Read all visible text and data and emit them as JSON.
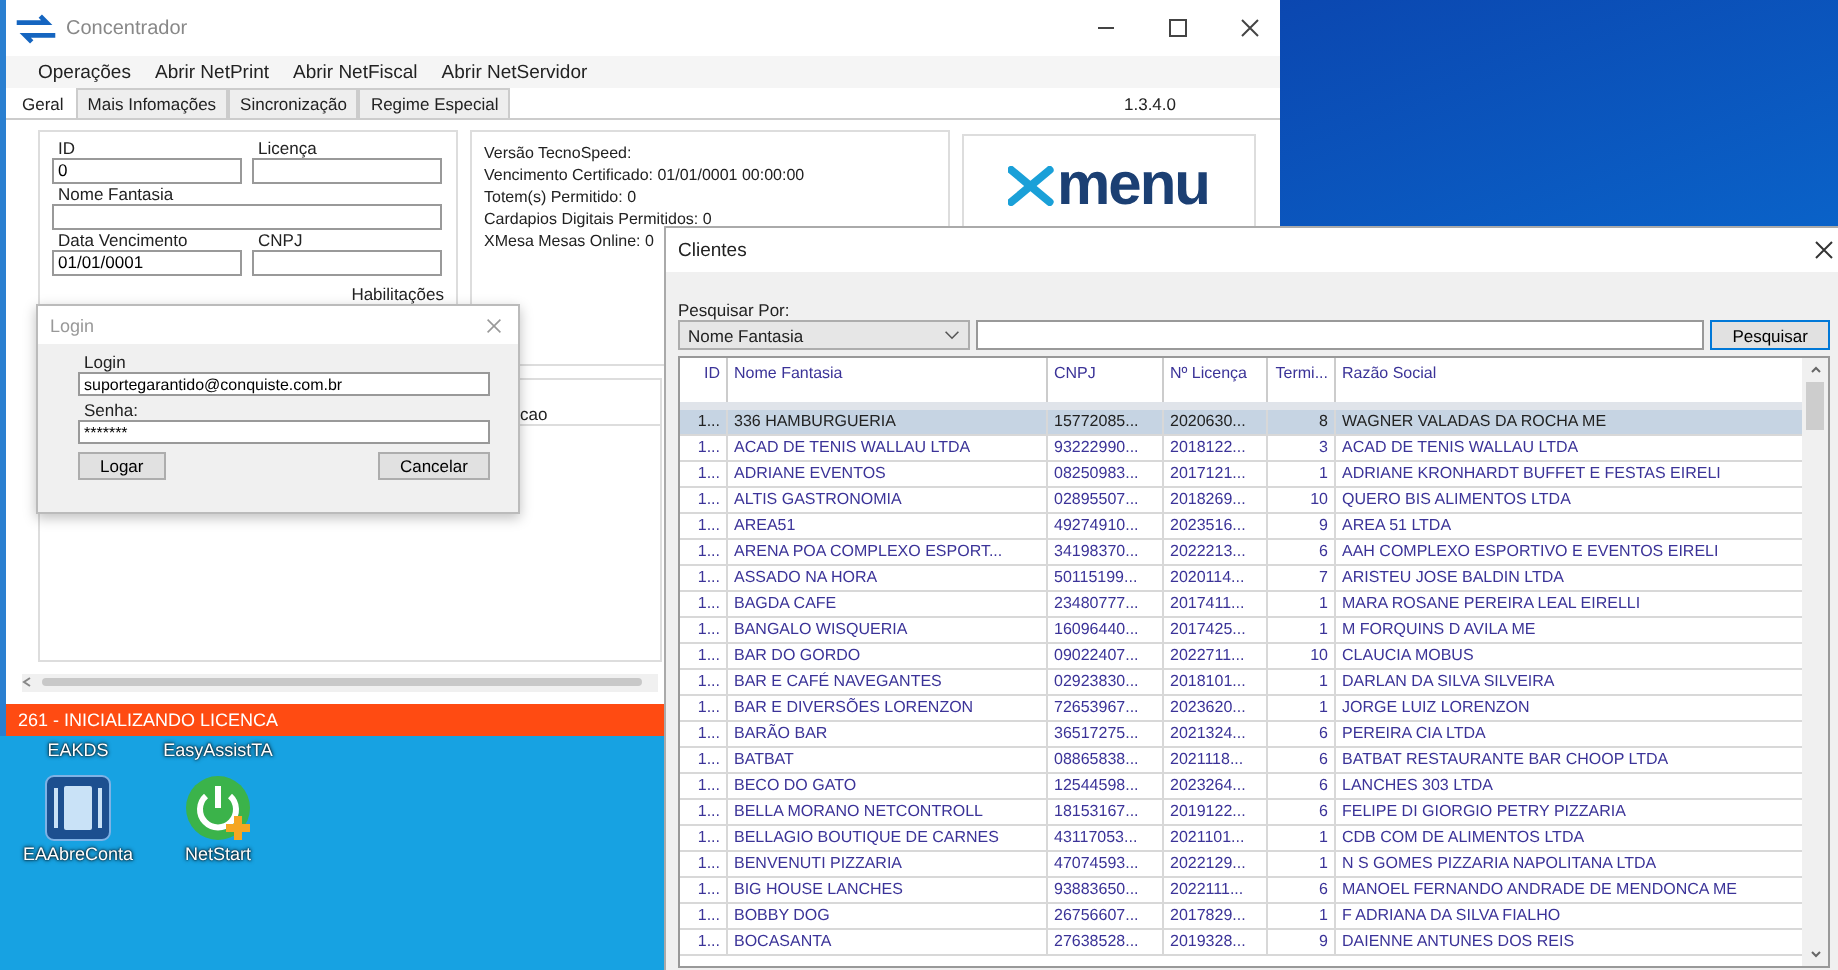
{
  "desktop": {
    "icons": [
      {
        "label": "EAKDS",
        "kind": "covered"
      },
      {
        "label": "EasyAssistTA",
        "kind": "covered"
      },
      {
        "label": "EAAbreConta",
        "kind": "menu-app"
      },
      {
        "label": "NetStart",
        "kind": "power-app"
      }
    ]
  },
  "main_window": {
    "title": "Concentrador",
    "menu": [
      "Operações",
      "Abrir NetPrint",
      "Abrir NetFiscal",
      "Abrir NetServidor"
    ],
    "tabs": [
      {
        "label": "Geral",
        "selected": true
      },
      {
        "label": "Mais Infomações",
        "selected": false
      },
      {
        "label": "Sincronização",
        "selected": false
      },
      {
        "label": "Regime Especial",
        "selected": false
      }
    ],
    "version": "1.3.4.0",
    "field_rows": [
      [
        {
          "label": "ID",
          "value": "0"
        },
        {
          "label": "Licença"
        }
      ],
      [
        {
          "label": "Nome Fantasia"
        }
      ],
      [
        {
          "label": "Data Vencimento",
          "value": "01/01/0001"
        },
        {
          "label": "CNPJ"
        }
      ]
    ],
    "section_label": "Habilitações",
    "info_lines": [
      "Versão TecnoSpeed:",
      "Vencimento Certificado: 01/01/0001 00:00:00",
      "Totem(s) Permitido: 0",
      "Cardapios Digitais Permitidos: 0",
      "XMesa Mesas Online: 0"
    ],
    "logo": "menu",
    "list_column": "cao",
    "status_bar": "261 - INICIALIZANDO LICENCA"
  },
  "login_dialog": {
    "title": "Login",
    "fields": [
      {
        "label": "Login",
        "value": "suportegarantido@conquiste.com.br"
      },
      {
        "label": "Senha:",
        "value": "*******"
      }
    ],
    "buttons": [
      "Logar",
      "Cancelar"
    ]
  },
  "clients_window": {
    "title": "Clientes",
    "search_label": "Pesquisar Por:",
    "search_by": "Nome Fantasia",
    "search_button": "Pesquisar",
    "columns": [
      "ID",
      "Nome Fantasia",
      "CNPJ",
      "Nº Licença",
      "Termi...",
      "Razão Social"
    ],
    "rows": [
      {
        "cells": [
          "1...",
          "336 HAMBURGUERIA",
          "15772085...",
          "2020630...",
          "8",
          "WAGNER VALADAS DA ROCHA ME"
        ],
        "selected": true
      },
      {
        "cells": [
          "1...",
          "ACAD DE TENIS WALLAU LTDA",
          "93222990...",
          "2018122...",
          "3",
          "ACAD DE TENIS WALLAU LTDA"
        ],
        "selected": false
      },
      {
        "cells": [
          "1...",
          "ADRIANE EVENTOS",
          "08250983...",
          "2017121...",
          "1",
          "ADRIANE KRONHARDT BUFFET E FESTAS EIRELI"
        ],
        "selected": false
      },
      {
        "cells": [
          "1...",
          "ALTIS GASTRONOMIA",
          "02895507...",
          "2018269...",
          "10",
          "QUERO BIS ALIMENTOS LTDA"
        ],
        "selected": false
      },
      {
        "cells": [
          "1...",
          "AREA51",
          "49274910...",
          "2023516...",
          "9",
          "AREA 51 LTDA"
        ],
        "selected": false
      },
      {
        "cells": [
          "1...",
          "ARENA POA  COMPLEXO ESPORT...",
          "34198370...",
          "2022213...",
          "6",
          "AAH COMPLEXO ESPORTIVO E EVENTOS EIRELI"
        ],
        "selected": false
      },
      {
        "cells": [
          "1...",
          "ASSADO NA HORA",
          "50115199...",
          "2020114...",
          "7",
          "ARISTEU JOSE BALDIN LTDA"
        ],
        "selected": false
      },
      {
        "cells": [
          "1...",
          "BAGDA CAFE",
          "23480777...",
          "2017411...",
          "1",
          "MARA ROSANE PEREIRA LEAL EIRELLI"
        ],
        "selected": false
      },
      {
        "cells": [
          "1...",
          "BANGALO WISQUERIA",
          "16096440...",
          "2017425...",
          "1",
          "M FORQUINS D AVILA ME"
        ],
        "selected": false
      },
      {
        "cells": [
          "1...",
          "BAR DO GORDO",
          "09022407...",
          "2022711...",
          "10",
          "CLAUCIA MOBUS"
        ],
        "selected": false
      },
      {
        "cells": [
          "1...",
          "BAR E CAFÉ NAVEGANTES",
          "02923830...",
          "2018101...",
          "1",
          "DARLAN DA SILVA SILVEIRA"
        ],
        "selected": false
      },
      {
        "cells": [
          "1...",
          "BAR E DIVERSÕES LORENZON",
          "72653967...",
          "2023620...",
          "1",
          "JORGE LUIZ LORENZON"
        ],
        "selected": false
      },
      {
        "cells": [
          "1...",
          "BARÃO BAR",
          "36517275...",
          "2021324...",
          "6",
          "PEREIRA  CIA LTDA"
        ],
        "selected": false
      },
      {
        "cells": [
          "1...",
          "BATBAT",
          "08865838...",
          "2021118...",
          "6",
          "BATBAT RESTAURANTE BAR CHOOP LTDA"
        ],
        "selected": false
      },
      {
        "cells": [
          "1...",
          "BECO DO GATO",
          "12544598...",
          "2023264...",
          "6",
          "LANCHES 303 LTDA"
        ],
        "selected": false
      },
      {
        "cells": [
          "1...",
          "BELLA MORANO NETCONTROLL",
          "18153167...",
          "2019122...",
          "6",
          "FELIPE DI GIORGIO PETRY PIZZARIA"
        ],
        "selected": false
      },
      {
        "cells": [
          "1...",
          "BELLAGIO BOUTIQUE DE CARNES",
          "43117053...",
          "2021101...",
          "1",
          "CDB COM DE ALIMENTOS LTDA"
        ],
        "selected": false
      },
      {
        "cells": [
          "1...",
          "BENVENUTI PIZZARIA",
          "47074593...",
          "2022129...",
          "1",
          "N S GOMES PIZZARIA NAPOLITANA LTDA"
        ],
        "selected": false
      },
      {
        "cells": [
          "1...",
          "BIG HOUSE LANCHES",
          "93883650...",
          "2022111...",
          "6",
          "MANOEL FERNANDO ANDRADE DE MENDONCA ME"
        ],
        "selected": false
      },
      {
        "cells": [
          "1...",
          "BOBBY DOG",
          "26756607...",
          "2017829...",
          "1",
          "F ADRIANA DA SILVA FIALHO"
        ],
        "selected": false
      },
      {
        "cells": [
          "1...",
          "BOCASANTA",
          "27638528...",
          "2019328...",
          "9",
          "DAIENNE ANTUNES DOS REIS"
        ],
        "selected": false
      }
    ]
  }
}
